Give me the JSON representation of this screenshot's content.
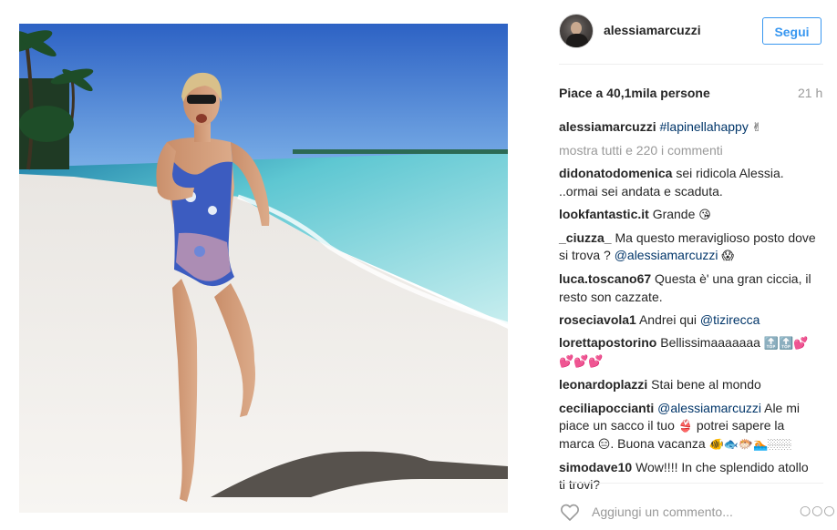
{
  "post": {
    "username": "alessiamarcuzzi",
    "follow_label": "Segui",
    "likes_text": "Piace a 40,1mila persone",
    "time_ago": "21 h"
  },
  "caption": {
    "username": "alessiamarcuzzi",
    "hashtag": "#lapinellahappy",
    "emoji": "✌"
  },
  "show_all_text": "mostra tutti e 220 i commenti",
  "comments": [
    {
      "user": "didonatodomenica",
      "text": "sei ridicola Alessia. ..ormai sei andata e scaduta."
    },
    {
      "user": "lookfantastic.it",
      "text": "Grande",
      "emoji": "😘"
    },
    {
      "user": "_ciuzza_",
      "text": "Ma questo meraviglioso posto dove si trova ?",
      "mention": "@alessiamarcuzzi",
      "emoji": "😱"
    },
    {
      "user": "luca.toscano67",
      "text": "Questa è' una gran ciccia, il resto son cazzate."
    },
    {
      "user": "roseciavola1",
      "text": "Andrei qui",
      "mention": "@tizirecca"
    },
    {
      "user": "lorettapostorino",
      "text": "Bellissimaaaaaaa",
      "emoji": "🔝🔝💕💕💕💕"
    },
    {
      "user": "leonardoplazzi",
      "text": "Stai bene al mondo"
    },
    {
      "user": "ceciliapoccianti",
      "mention": "@alessiamarcuzzi",
      "text": "Ale mi piace un sacco il tuo",
      "emoji_mid": "👙",
      "text2": "potrei sapere la marca",
      "emoji_mid2": "😑",
      "text3": ". Buona vacanza",
      "emoji_end": "🐠🐟🐡🏊🏼🏼🏼"
    },
    {
      "user": "simodave10",
      "text": "Wow!!!! In che splendido atollo ti trovi?"
    }
  ],
  "composer": {
    "placeholder": "Aggiungi un commento...",
    "more_glyph": "○○○"
  },
  "icons": {
    "like": "heart-outline-icon",
    "more": "more-options-icon"
  },
  "colors": {
    "link_blue": "#003569",
    "button_blue": "#3897f0",
    "muted": "#999999",
    "text": "#262626"
  }
}
